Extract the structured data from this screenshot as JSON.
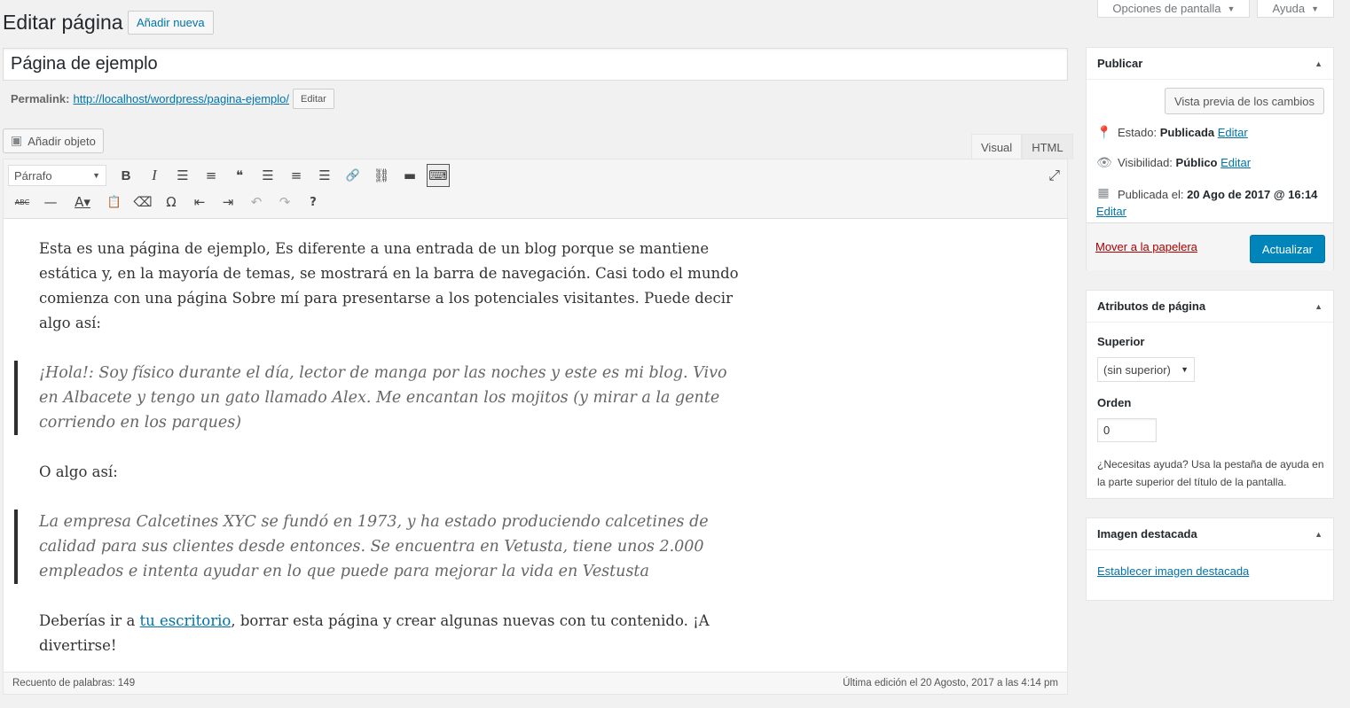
{
  "screen_tabs": {
    "options": "Opciones de pantalla",
    "help": "Ayuda"
  },
  "header": {
    "title": "Editar página",
    "add_new": "Añadir nueva"
  },
  "post": {
    "title": "Página de ejemplo"
  },
  "permalink": {
    "label": "Permalink:",
    "url_base": "http://localhost/wordpress/",
    "slug": "pagina-ejemplo",
    "trail": "/",
    "edit": "Editar"
  },
  "media": {
    "add": "Añadir objeto"
  },
  "editor_tabs": {
    "visual": "Visual",
    "html": "HTML"
  },
  "toolbar": {
    "format": "Párrafo",
    "row1": [
      {
        "name": "bold-icon",
        "glyph": "B"
      },
      {
        "name": "italic-icon",
        "glyph": "I"
      },
      {
        "name": "bullet-list-icon",
        "glyph": "☰"
      },
      {
        "name": "numbered-list-icon",
        "glyph": "≡"
      },
      {
        "name": "blockquote-icon",
        "glyph": "❝"
      },
      {
        "name": "align-left-icon",
        "glyph": "☰"
      },
      {
        "name": "align-center-icon",
        "glyph": "≡"
      },
      {
        "name": "align-right-icon",
        "glyph": "☰"
      },
      {
        "name": "link-icon",
        "glyph": "🔗"
      },
      {
        "name": "unlink-icon",
        "glyph": "⛓"
      },
      {
        "name": "read-more-icon",
        "glyph": "▬"
      },
      {
        "name": "toolbar-toggle-icon",
        "glyph": "⌨"
      }
    ],
    "row2": [
      {
        "name": "strikethrough-icon",
        "glyph": "ABC"
      },
      {
        "name": "horizontal-line-icon",
        "glyph": "—"
      },
      {
        "name": "text-color-icon",
        "glyph": "A▾"
      },
      {
        "name": "paste-text-icon",
        "glyph": "📋"
      },
      {
        "name": "clear-formatting-icon",
        "glyph": "⌫"
      },
      {
        "name": "special-character-icon",
        "glyph": "Ω"
      },
      {
        "name": "outdent-icon",
        "glyph": "⇤"
      },
      {
        "name": "indent-icon",
        "glyph": "⇥"
      },
      {
        "name": "undo-icon",
        "glyph": "↶"
      },
      {
        "name": "redo-icon",
        "glyph": "↷"
      },
      {
        "name": "help-icon",
        "glyph": "?"
      }
    ]
  },
  "content": {
    "p1": "Esta es una página de ejemplo, Es diferente a una entrada de un blog porque se mantiene estática y, en la mayoría de temas, se mostrará en la barra de navegación. Casi todo el mundo comienza con una página Sobre mí para presentarse a los potenciales visitantes. Puede decir algo así:",
    "quote1": "¡Hola!: Soy físico durante el día, lector de manga por las noches y este es mi blog. Vivo en Albacete y tengo un gato llamado Alex. Me encantan los mojitos (y mirar a la gente corriendo en los parques)",
    "p2": "O algo así:",
    "quote2": "La empresa Calcetines XYC se fundó en 1973, y ha estado produciendo calcetines de calidad para sus clientes desde entonces. Se encuentra en Vetusta, tiene unos 2.000 empleados e intenta ayudar en lo que puede para mejorar la vida en Vestusta",
    "p3_before": "Deberías ir a ",
    "p3_link": "tu escritorio",
    "p3_after": ", borrar esta página y crear algunas nuevas con tu contenido. ¡A divertirse!"
  },
  "status_bar": {
    "word_count": "Recuento de palabras: 149",
    "last_edit": "Última edición el 20 Agosto, 2017 a las 4:14 pm"
  },
  "publish": {
    "title": "Publicar",
    "preview": "Vista previa de los cambios",
    "status_label": "Estado:",
    "status_value": "Publicada",
    "status_edit": "Editar",
    "visibility_label": "Visibilidad:",
    "visibility_value": "Público",
    "visibility_edit": "Editar",
    "published_label": "Publicada el:",
    "published_value": "20 Ago de 2017 @ 16:14",
    "published_edit": "Editar",
    "trash": "Mover a la papelera",
    "update": "Actualizar"
  },
  "attributes": {
    "title": "Atributos de página",
    "parent_label": "Superior",
    "parent_value": "(sin superior)",
    "order_label": "Orden",
    "order_value": "0",
    "help": "¿Necesitas ayuda? Usa la pestaña de ayuda en la parte superior del título de la pantalla."
  },
  "featured_image": {
    "title": "Imagen destacada",
    "set": "Establecer imagen destacada"
  }
}
